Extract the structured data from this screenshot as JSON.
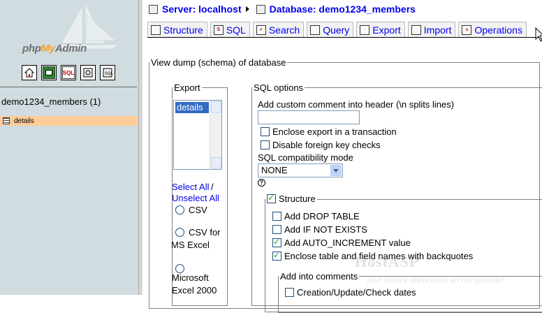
{
  "left": {
    "logo": {
      "php": "php",
      "my": "My",
      "admin": "Admin"
    },
    "quick_icons": [
      "home-icon",
      "query-window-icon",
      "sql-icon",
      "docs-icon",
      "docs-sql-icon"
    ],
    "sql_icon_text": "SQL",
    "database": "demo1234_members (1)",
    "tables": [
      {
        "label": "details",
        "icon": "table-icon"
      }
    ]
  },
  "breadcrumb": {
    "server": "Server: localhost",
    "database": "Database: demo1234_members"
  },
  "tabs": [
    {
      "label": "Structure",
      "icon": "structure-icon"
    },
    {
      "label": "SQL",
      "icon": "sql-icon"
    },
    {
      "label": "Search",
      "icon": "search-icon"
    },
    {
      "label": "Query",
      "icon": "query-icon"
    },
    {
      "label": "Export",
      "icon": "export-icon"
    },
    {
      "label": "Import",
      "icon": "import-icon"
    },
    {
      "label": "Operations",
      "icon": "operations-icon"
    }
  ],
  "main": {
    "legend": "View dump (schema) of database",
    "export": {
      "legend": "Export",
      "selected_table": "details",
      "select_all": "Select All",
      "separator": " /",
      "unselect_all": "Unselect All",
      "formats": [
        "CSV",
        "CSV for MS Excel",
        "Microsoft Excel 2000"
      ]
    },
    "sql_options": {
      "legend": "SQL options",
      "comment_label": "Add custom comment into header (\\n splits lines)",
      "comment_value": "",
      "enclose_transaction": "Enclose export in a transaction",
      "disable_fk": "Disable foreign key checks",
      "compat_label": "SQL compatibility mode",
      "compat_value": "NONE",
      "help_glyph": "?",
      "structure": {
        "legend": "Structure",
        "add_drop_table": "Add DROP TABLE",
        "add_if_not_exists": "Add IF NOT EXISTS",
        "add_auto_increment": "Add AUTO_INCREMENT value",
        "enclose_backquotes": "Enclose table and field names with backquotes",
        "comments": {
          "legend": "Add into comments",
          "creation_dates": "Creation/Update/Check dates"
        }
      }
    }
  },
  "watermark": {
    "title": "HostASP",
    "subtitle": "your trusted application service provider"
  }
}
